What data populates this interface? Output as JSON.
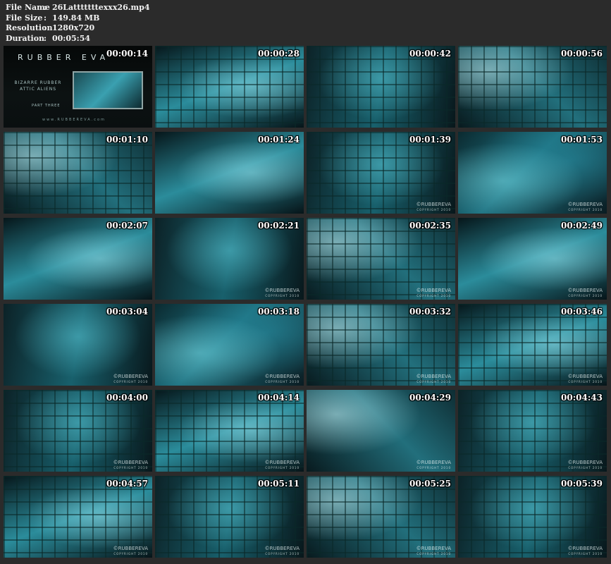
{
  "file_info": {
    "file_name_label": "File Name",
    "file_name": "26Latttttttexxx26.mp4",
    "file_size_label": "File Size",
    "file_size": "149.84 MB",
    "resolution_label": "Resolution",
    "resolution": "1280x720",
    "duration_label": "Duration",
    "duration": "00:05:54",
    "separator": ":"
  },
  "title_card": {
    "logo": "RUBBER EVA",
    "subtitle_1": "BIZARRE RUBBER",
    "subtitle_2": "ATTIC ALIENS",
    "part": "PART THREE",
    "url": "www.RUBBEREVA.com"
  },
  "watermark": {
    "brand": "©RUBBEREVA",
    "copyright": "COPYRIGHT 2010"
  },
  "thumbnails": [
    {
      "timestamp": "00:00:14"
    },
    {
      "timestamp": "00:00:28"
    },
    {
      "timestamp": "00:00:42"
    },
    {
      "timestamp": "00:00:56"
    },
    {
      "timestamp": "00:01:10"
    },
    {
      "timestamp": "00:01:24"
    },
    {
      "timestamp": "00:01:39"
    },
    {
      "timestamp": "00:01:53"
    },
    {
      "timestamp": "00:02:07"
    },
    {
      "timestamp": "00:02:21"
    },
    {
      "timestamp": "00:02:35"
    },
    {
      "timestamp": "00:02:49"
    },
    {
      "timestamp": "00:03:04"
    },
    {
      "timestamp": "00:03:18"
    },
    {
      "timestamp": "00:03:32"
    },
    {
      "timestamp": "00:03:46"
    },
    {
      "timestamp": "00:04:00"
    },
    {
      "timestamp": "00:04:14"
    },
    {
      "timestamp": "00:04:29"
    },
    {
      "timestamp": "00:04:43"
    },
    {
      "timestamp": "00:04:57"
    },
    {
      "timestamp": "00:05:11"
    },
    {
      "timestamp": "00:05:25"
    },
    {
      "timestamp": "00:05:39"
    }
  ],
  "colors": {
    "background": "#2b2b2b",
    "header_text": "#f2f2f2",
    "timestamp_text": "#ffffff",
    "tint": "#1d6f7e"
  }
}
